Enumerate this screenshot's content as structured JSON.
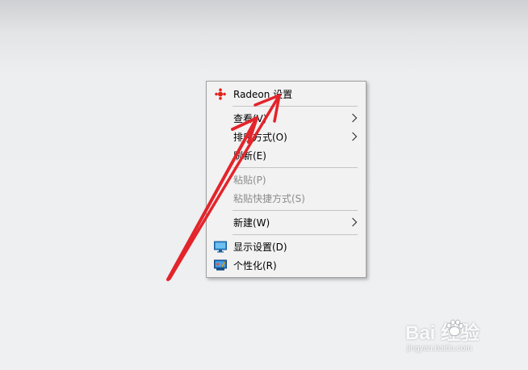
{
  "context_menu": {
    "items": [
      {
        "label": "Radeon 设置",
        "icon": "radeon-icon",
        "enabled": true,
        "has_submenu": false
      },
      {
        "label": "查看(V)",
        "icon": "",
        "enabled": true,
        "has_submenu": true
      },
      {
        "label": "排序方式(O)",
        "icon": "",
        "enabled": true,
        "has_submenu": true
      },
      {
        "label": "刷新(E)",
        "icon": "",
        "enabled": true,
        "has_submenu": false
      },
      {
        "label": "粘贴(P)",
        "icon": "",
        "enabled": false,
        "has_submenu": false
      },
      {
        "label": "粘贴快捷方式(S)",
        "icon": "",
        "enabled": false,
        "has_submenu": false
      },
      {
        "label": "新建(W)",
        "icon": "",
        "enabled": true,
        "has_submenu": true
      },
      {
        "label": "显示设置(D)",
        "icon": "display-icon",
        "enabled": true,
        "has_submenu": false
      },
      {
        "label": "个性化(R)",
        "icon": "personalize-icon",
        "enabled": true,
        "has_submenu": false
      }
    ]
  },
  "watermark": {
    "brand": "Bai 经验",
    "sub": "jingyan.baidu.com"
  },
  "colors": {
    "annotation": "#e3242b",
    "radeon": "#e2231a",
    "menu_bg": "#f2f2f2",
    "disabled_text": "#8c8c8c"
  }
}
